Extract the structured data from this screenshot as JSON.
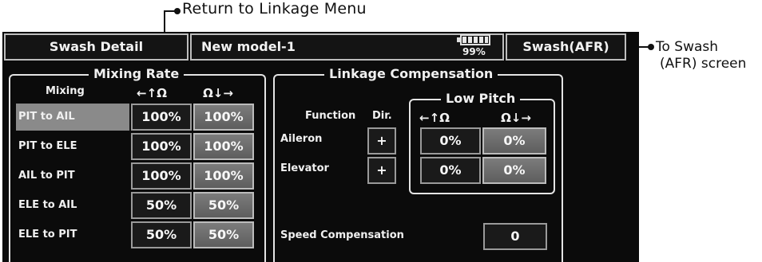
{
  "callouts": {
    "return": "Return to Linkage Menu",
    "swash_line1": "To Swash",
    "swash_line2": "(AFR) screen"
  },
  "header": {
    "title": "Swash Detail",
    "model": "New model-1",
    "battery_percent": "99%",
    "battery_level": 1.0,
    "swash_button": "Swash(AFR)"
  },
  "mixing_rate": {
    "title": "Mixing Rate",
    "mixing_header": "Mixing",
    "col1_header": "←↑Ω",
    "col2_header": "Ω↓→",
    "rows": [
      {
        "label": "PIT to AIL",
        "v1": "100%",
        "v2": "100%",
        "selected": true
      },
      {
        "label": "PIT to ELE",
        "v1": "100%",
        "v2": "100%",
        "selected": false
      },
      {
        "label": "AIL to PIT",
        "v1": "100%",
        "v2": "100%",
        "selected": false
      },
      {
        "label": "ELE to AIL",
        "v1": "50%",
        "v2": "50%",
        "selected": false
      },
      {
        "label": "ELE to PIT",
        "v1": "50%",
        "v2": "50%",
        "selected": false
      }
    ]
  },
  "linkage": {
    "title": "Linkage Compensation",
    "function_header": "Function",
    "dir_header": "Dir.",
    "low_pitch_title": "Low Pitch",
    "lp_col1_header": "←↑Ω",
    "lp_col2_header": "Ω↓→",
    "rows": [
      {
        "label": "Aileron",
        "dir": "+",
        "v1": "0%",
        "v2": "0%"
      },
      {
        "label": "Elevator",
        "dir": "+",
        "v1": "0%",
        "v2": "0%"
      }
    ],
    "speed_label": "Speed Compensation",
    "speed_value": "0"
  }
}
